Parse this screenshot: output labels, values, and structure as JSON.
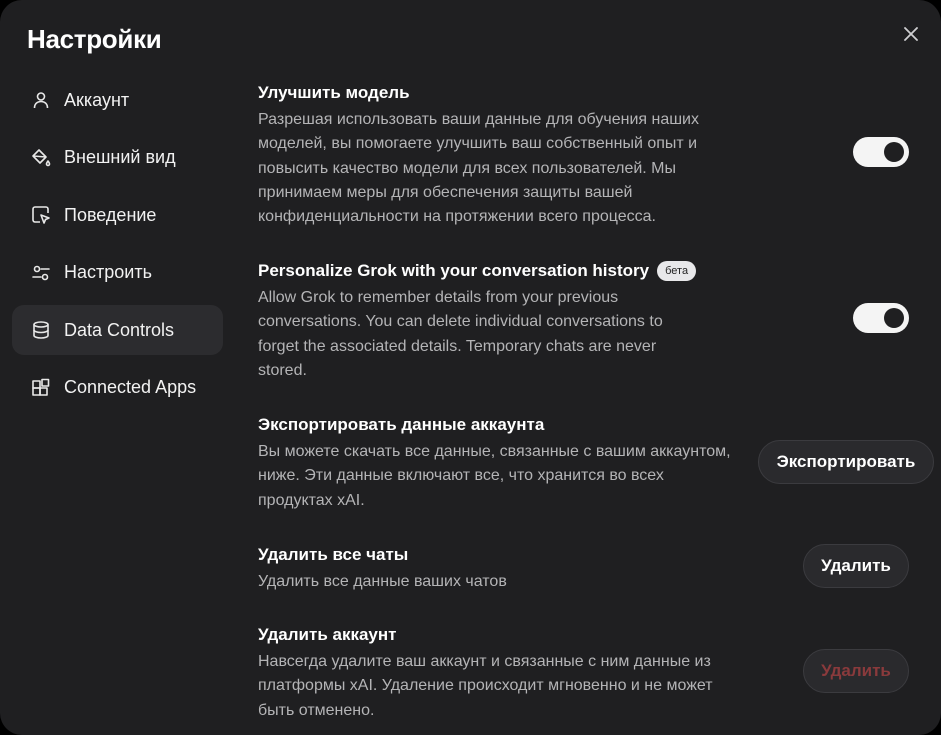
{
  "dialog": {
    "title": "Настройки",
    "close_icon": "close-icon"
  },
  "sidebar": {
    "items": [
      {
        "label": "Аккаунт",
        "icon": "user-icon"
      },
      {
        "label": "Внешний вид",
        "icon": "paint-bucket-icon"
      },
      {
        "label": "Поведение",
        "icon": "cursor-icon"
      },
      {
        "label": "Настроить",
        "icon": "sliders-icon"
      },
      {
        "label": "Data Controls",
        "icon": "database-icon",
        "active": true
      },
      {
        "label": "Connected Apps",
        "icon": "apps-grid-icon"
      }
    ]
  },
  "settings": {
    "improve_model": {
      "title": "Улучшить модель",
      "description": "Разрешая использовать ваши данные для обучения наших моделей, вы помогаете улучшить ваш собственный опыт и повысить качество модели для всех пользователей. Мы принимаем меры для обеспечения защиты вашей конфиденциальности на протяжении всего процесса.",
      "enabled": true
    },
    "personalize": {
      "title": "Personalize Grok with your conversation history",
      "badge": "бета",
      "description": "Allow Grok to remember details from your previous conversations. You can delete individual conversations to forget the associated details. Temporary chats are never stored.",
      "enabled": true
    },
    "export": {
      "title": "Экспортировать данные аккаунта",
      "description": "Вы можете скачать все данные, связанные с вашим аккаунтом, ниже. Эти данные включают все, что хранится во всех продуктах xAI.",
      "button": "Экспортировать"
    },
    "delete_chats": {
      "title": "Удалить все чаты",
      "description": "Удалить все данные ваших чатов",
      "button": "Удалить"
    },
    "delete_account": {
      "title": "Удалить аккаунт",
      "description": "Навсегда удалите ваш аккаунт и связанные с ним данные из платформы xAI. Удаление происходит мгновенно и не может быть отменено.",
      "button": "Удалить"
    }
  },
  "colors": {
    "background": "#1f1f21",
    "active_nav": "#2c2c2f",
    "muted_text": "#b4b4b6",
    "danger_text": "#8a3a3c"
  }
}
